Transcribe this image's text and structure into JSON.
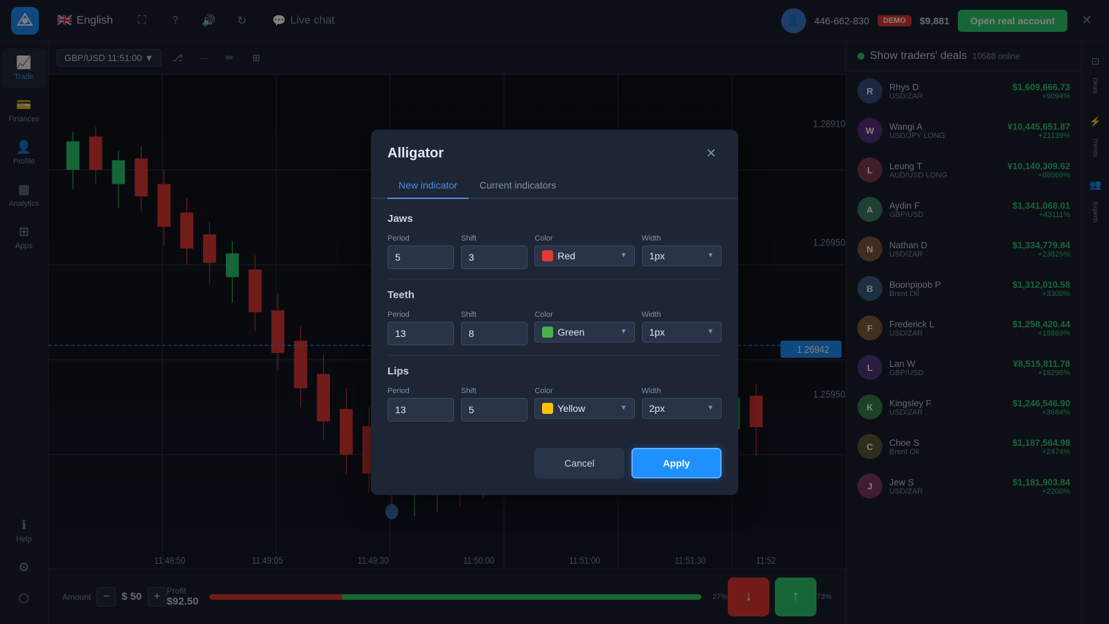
{
  "navbar": {
    "logo": "P",
    "lang": "English",
    "livechat_label": "Live chat",
    "user_id": "446-662-830",
    "demo_label": "DEMO",
    "balance": "$9,881",
    "open_account_label": "Open real account"
  },
  "sidebar": {
    "items": [
      {
        "id": "trade",
        "label": "Trade",
        "active": true
      },
      {
        "id": "finances",
        "label": "Finances"
      },
      {
        "id": "profile",
        "label": "Profile"
      },
      {
        "id": "analytics",
        "label": "Analytics"
      },
      {
        "id": "apps",
        "label": "Apps"
      }
    ],
    "bottom": [
      {
        "id": "settings",
        "label": "Settings"
      },
      {
        "id": "exit",
        "label": "Exit"
      }
    ]
  },
  "chart": {
    "symbol": "GBP/USD 11:51:00",
    "price_levels": [
      "1.28910",
      "1.26950",
      "1.25950",
      "1.26942"
    ],
    "bottom": {
      "amount_label": "Amount",
      "amount_value": "$ 50",
      "profit_label": "Profit",
      "profit_value": "$92.50",
      "progress_left": "27%",
      "progress_right": "73%"
    }
  },
  "right_panel": {
    "header": "Show traders' deals",
    "online_count": "10588 online",
    "traders": [
      {
        "name": "Rhys D",
        "pair": "USD/ZAR",
        "amount": "$1,609,666.73",
        "change": "+9094%",
        "positive": true,
        "initials": "R"
      },
      {
        "name": "Wangi A",
        "pair": "USD/JPY LONG",
        "amount": "¥10,445,651.87",
        "change": "+21139%",
        "positive": true,
        "initials": "W"
      },
      {
        "name": "Leung T",
        "pair": "AUD/USD LONG",
        "amount": "¥10,140,309.62",
        "change": "+88069%",
        "positive": true,
        "initials": "L"
      },
      {
        "name": "Aydin F",
        "pair": "GBP/USD",
        "amount": "$1,341,068.01",
        "change": "+43111%",
        "positive": true,
        "initials": "A"
      },
      {
        "name": "Nathan D",
        "pair": "USD/ZAR",
        "amount": "$1,334,779.84",
        "change": "+23825%",
        "positive": true,
        "initials": "N"
      },
      {
        "name": "Boonpipob P",
        "pair": "Brent Oil",
        "amount": "$1,312,010.58",
        "change": "+3300%",
        "positive": true,
        "initials": "B"
      },
      {
        "name": "Frederick L",
        "pair": "USD/ZAR",
        "amount": "$1,258,420.44",
        "change": "+18869%",
        "positive": true,
        "initials": "F"
      },
      {
        "name": "Lan W",
        "pair": "GBP/USD",
        "amount": "¥8,515,811.78",
        "change": "+18296%",
        "positive": true,
        "initials": "L"
      },
      {
        "name": "Kingsley F",
        "pair": "USD/ZAR",
        "amount": "$1,246,546.90",
        "change": "+3684%",
        "positive": true,
        "initials": "K"
      },
      {
        "name": "Choe S",
        "pair": "Brent Oil",
        "amount": "$1,187,564.98",
        "change": "+2474%",
        "positive": true,
        "initials": "C"
      },
      {
        "name": "Jew S",
        "pair": "USD/ZAR",
        "amount": "$1,181,903.84",
        "change": "+2200%",
        "positive": true,
        "initials": "J"
      }
    ]
  },
  "modal": {
    "title": "Alligator",
    "tabs": [
      "New indicator",
      "Current indicators"
    ],
    "active_tab": "New indicator",
    "sections": {
      "jaws": {
        "label": "Jaws",
        "period_label": "Period",
        "period_value": "5",
        "shift_label": "Shift",
        "shift_value": "3",
        "color_label": "Color",
        "color_value": "Red",
        "color_hex": "#e53935",
        "width_label": "Width",
        "width_value": "1px"
      },
      "teeth": {
        "label": "Teeth",
        "period_label": "Period",
        "period_value": "13",
        "shift_label": "Shift",
        "shift_value": "8",
        "color_label": "Color",
        "color_value": "Green",
        "color_hex": "#4caf50",
        "width_label": "Width",
        "width_value": "1px"
      },
      "lips": {
        "label": "Lips",
        "period_label": "Period",
        "period_value": "13",
        "shift_label": "Shift",
        "shift_value": "5",
        "color_label": "Color",
        "color_value": "Yellow",
        "color_hex": "#ffc107",
        "width_label": "Width",
        "width_value": "2px"
      }
    },
    "cancel_label": "Cancel",
    "apply_label": "Apply"
  },
  "far_right": {
    "labels": [
      "Deals",
      "Trends",
      "Experts"
    ]
  }
}
